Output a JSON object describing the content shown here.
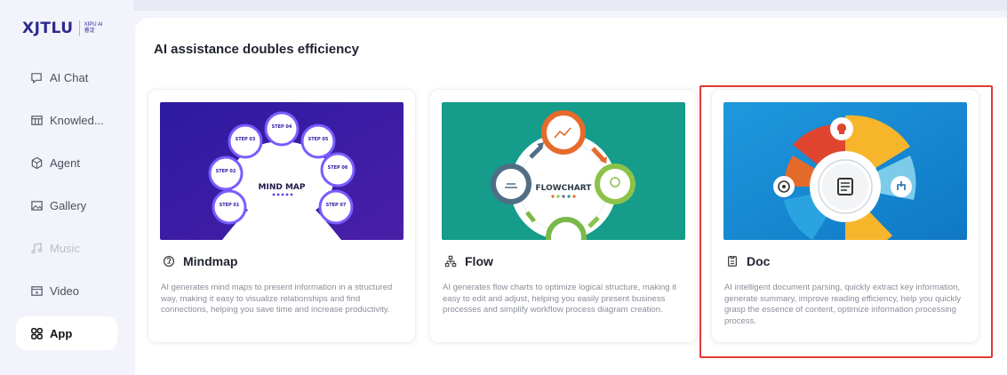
{
  "brand": {
    "logo_main": "XJTLU",
    "logo_sub_top": "XIPU AI",
    "logo_sub_bottom": "睿淀"
  },
  "sidebar": {
    "items": [
      {
        "label": "AI Chat",
        "icon": "chat-icon",
        "state": "normal"
      },
      {
        "label": "Knowled...",
        "icon": "knowledge-icon",
        "state": "normal"
      },
      {
        "label": "Agent",
        "icon": "agent-icon",
        "state": "normal"
      },
      {
        "label": "Gallery",
        "icon": "gallery-icon",
        "state": "normal"
      },
      {
        "label": "Music",
        "icon": "music-icon",
        "state": "disabled"
      },
      {
        "label": "Video",
        "icon": "video-icon",
        "state": "normal"
      },
      {
        "label": "App",
        "icon": "app-grid-icon",
        "state": "active"
      }
    ]
  },
  "main": {
    "section_title": "AI assistance doubles efficiency",
    "cards": [
      {
        "title": "Mindmap",
        "icon": "mindmap-icon",
        "image_label": "MIND MAP",
        "steps": [
          "STEP 01",
          "STEP 02",
          "STEP 03",
          "STEP 04",
          "STEP 05",
          "STEP 06",
          "STEP 07"
        ],
        "description": "AI generates mind maps to present information in a structured way, making it easy to visualize relationships and find connections, helping you save time and increase productivity."
      },
      {
        "title": "Flow",
        "icon": "flow-icon",
        "image_label": "FLOWCHART",
        "description": "AI generates flow charts to optimize logical structure, making it easy to edit and adjust, helping you easily present business processes and simplify workflow process diagram creation."
      },
      {
        "title": "Doc",
        "icon": "doc-icon",
        "description": "AI intelligent document parsing, quickly extract key information, generate summary, improve reading efficiency, help you quickly grasp the essence of content, optimize information processing process."
      }
    ]
  },
  "colors": {
    "accent": "#2e2a8f",
    "highlight": "#e03a36",
    "mindmap_bg": "#3a1f9e",
    "flow_bg": "#159c8b",
    "doc_bg": "#1389cf"
  }
}
